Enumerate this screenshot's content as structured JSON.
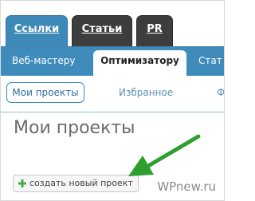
{
  "top_tabs": {
    "links": "Ссылки",
    "articles": "Статьи",
    "pr": "PR"
  },
  "subnav": {
    "webmaster": "Веб-мастеру",
    "optimizer": "Оптимизатору",
    "stat": "Стат"
  },
  "filters": {
    "my_projects": "Мои проекты",
    "favorites": "Избранное",
    "more": "Ф"
  },
  "page": {
    "title": "Мои проекты"
  },
  "actions": {
    "create_project": "создать новый проект"
  },
  "watermark": "WPnew.ru",
  "colors": {
    "accent_blue": "#3f8cbc",
    "dark_tab": "#3d3d3d",
    "arrow_green": "#2e9e2e",
    "plus_green": "#4aa84a"
  }
}
